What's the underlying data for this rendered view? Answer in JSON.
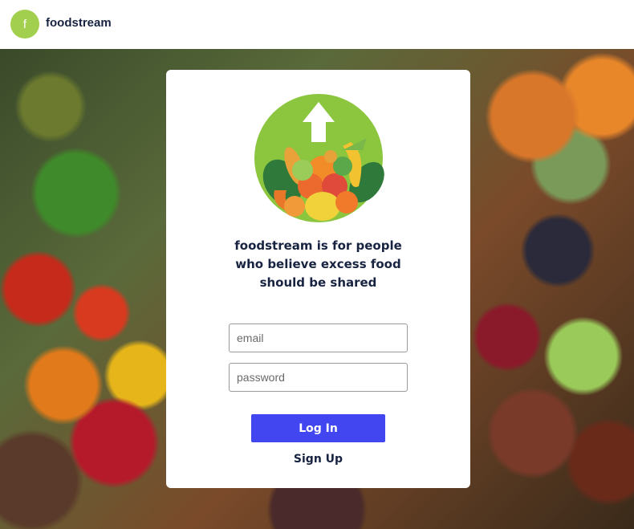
{
  "header": {
    "logo_letter": "f",
    "brand_name": "foodstream",
    "logo_color": "#a3cf4e"
  },
  "card": {
    "tagline_lines": [
      "foodstream is for people",
      "who believe excess food",
      "should be shared"
    ],
    "email_placeholder": "email",
    "password_placeholder": "password",
    "login_label": "Log In",
    "signup_label": "Sign Up",
    "accent_color": "#4146f0"
  }
}
